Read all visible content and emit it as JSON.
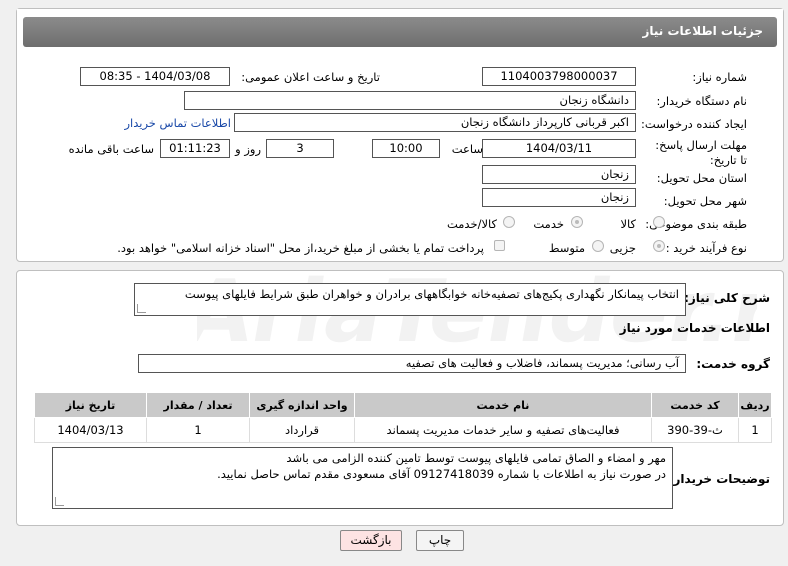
{
  "header": {
    "title": "جزئیات اطلاعات نیاز"
  },
  "fields": {
    "need_number": {
      "label": "شماره نیاز:",
      "value": "1104003798000037"
    },
    "announce_datetime": {
      "label": "تاریخ و ساعت اعلان عمومی:",
      "value": "1404/03/08 - 08:35"
    },
    "buyer_org": {
      "label": "نام دستگاه خریدار:",
      "value": "دانشگاه زنجان"
    },
    "requester": {
      "label": "ایجاد کننده درخواست:",
      "value": "اکبر قربانی کارپرداز دانشگاه زنجان",
      "link": "اطلاعات تماس خریدار"
    },
    "deadline": {
      "label": "مهلت ارسال پاسخ: تا تاریخ:",
      "date": "1404/03/11",
      "time_label": "ساعت",
      "time": "10:00",
      "days": "3",
      "days_label": "روز و",
      "remaining": "01:11:23",
      "remaining_label": "ساعت باقی مانده"
    },
    "province": {
      "label": "استان محل تحویل:",
      "value": "زنجان"
    },
    "city": {
      "label": "شهر محل تحویل:",
      "value": "زنجان"
    },
    "category": {
      "label": "طبقه بندی موضوعی:",
      "options": [
        "کالا",
        "خدمت",
        "کالا/خدمت"
      ],
      "selected": "خدمت"
    },
    "process": {
      "label": "نوع فرآیند خرید :",
      "options": [
        "جزیی",
        "متوسط"
      ],
      "selected": "جزیی",
      "treasury_text": "پرداخت تمام یا بخشی از مبلغ خرید،از محل \"اسناد خزانه اسلامی\" خواهد بود."
    }
  },
  "description": {
    "label": "شرح کلی نیاز:",
    "value": "انتخاب پیمانکار نگهداری پکیج‌های تصفیه‌خانه خوابگاههای برادران و خواهران طبق شرایط فایلهای پیوست"
  },
  "services": {
    "section_title": "اطلاعات خدمات مورد نیاز",
    "group_label": "گروه خدمت:",
    "group_value": "آب رسانی؛ مدیریت پسماند، فاضلاب و فعالیت های تصفیه",
    "columns": [
      "ردیف",
      "کد خدمت",
      "نام خدمت",
      "واحد اندازه گیری",
      "تعداد / مقدار",
      "تاریخ نیاز"
    ],
    "rows": [
      [
        "1",
        "ث-39-390",
        "فعالیت‌های تصفیه و سایر خدمات مدیریت پسماند",
        "قرارداد",
        "1",
        "1404/03/13"
      ]
    ]
  },
  "buyer_notes": {
    "label": "توضیحات خریدار:",
    "line1": "مهر و امضاء و الصاق تمامی فایلهای پیوست توسط تامین کننده الزامی می باشد",
    "line2": "در صورت نیاز به اطلاعات با شماره 09127418039 آقای مسعودی مقدم تماس حاصل نمایید."
  },
  "buttons": {
    "print": "چاپ",
    "back": "بازگشت"
  },
  "watermark": {
    "text": "AriaTender.neT"
  },
  "colors": {
    "header_bar": "#7a7a7a",
    "link": "#1a49a8",
    "back_button": "#fde3e3",
    "table_header": "#c9c9c9"
  }
}
